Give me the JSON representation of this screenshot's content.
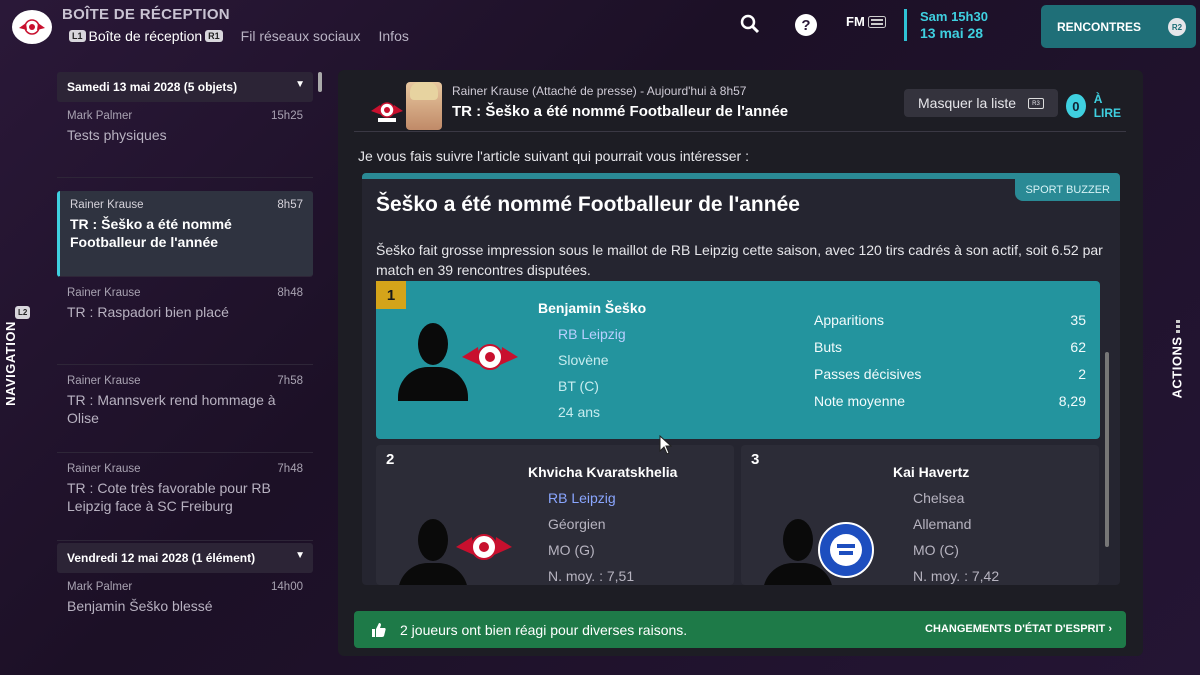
{
  "header": {
    "title": "BOÎTE DE RÉCEPTION",
    "hint_l1": "L1",
    "hint_r1": "R1",
    "tabs": [
      "Boîte de réception",
      "Fil réseaux sociaux",
      "Infos"
    ],
    "fm_label": "FM",
    "date_line1": "Sam 15h30",
    "date_line2": "13 mai 28",
    "matches_button": "RENCONTRES",
    "matches_hint": "R2",
    "icons": [
      "search-icon",
      "help-icon",
      "fm-keyboard-icon"
    ]
  },
  "side_nav": {
    "label": "NAVIGATION",
    "hint": "L2"
  },
  "side_actions": {
    "label": "ACTIONS"
  },
  "inbox": {
    "group1": "Samedi 13 mai 2028 (5 objets)",
    "group2": "Vendredi 12 mai 2028 (1 élément)",
    "messages": [
      {
        "sender": "Mark Palmer",
        "time": "15h25",
        "subject": "Tests physiques"
      },
      {
        "sender": "Rainer Krause",
        "time": "8h57",
        "subject": "TR : Šeško a été nommé Footballeur de l'année"
      },
      {
        "sender": "Rainer Krause",
        "time": "8h48",
        "subject": "TR : Raspadori bien placé"
      },
      {
        "sender": "Rainer Krause",
        "time": "7h58",
        "subject": "TR : Mannsverk rend hommage à Olise"
      },
      {
        "sender": "Rainer Krause",
        "time": "7h48",
        "subject": "TR : Cote très favorable pour RB Leipzig face à SC Freiburg"
      },
      {
        "sender": "Mark Palmer",
        "time": "14h00",
        "subject": "Benjamin Šeško blessé"
      }
    ]
  },
  "message": {
    "from": "Rainer Krause  (Attaché de presse)  -  Aujourd'hui à 8h57",
    "subject": "TR : Šeško a été nommé Footballeur de l'année",
    "hide_list": "Masquer la liste",
    "hide_hint": "R3",
    "unread_count": "0",
    "unread_label": "À LIRE",
    "intro": "Je vous fais suivre l'article suivant qui pourrait vous intéresser :"
  },
  "article": {
    "tag": "SPORT BUZZER",
    "title": "Šeško a été nommé Footballeur de l'année",
    "body": "Šeško fait grosse impression sous le maillot de RB Leipzig cette saison, avec 120 tirs cadrés à son actif, soit 6.52 par match en 39 rencontres disputées.",
    "first": {
      "rank": "1",
      "name": "Benjamin Šeško",
      "club": "RB Leipzig",
      "nationality": "Slovène",
      "position": "BT (C)",
      "age": "24 ans",
      "stats": [
        {
          "label": "Apparitions",
          "value": "35"
        },
        {
          "label": "Buts",
          "value": "62"
        },
        {
          "label": "Passes décisives",
          "value": "2"
        },
        {
          "label": "Note moyenne",
          "value": "8,29"
        }
      ]
    },
    "second": {
      "rank": "2",
      "name": "Khvicha Kvaratskhelia",
      "club": "RB Leipzig",
      "nationality": "Géorgien",
      "position": "MO (G)",
      "rating": "N. moy. : 7,51"
    },
    "third": {
      "rank": "3",
      "name": "Kai Havertz",
      "club": "Chelsea",
      "nationality": "Allemand",
      "position": "MO (C)",
      "rating": "N. moy. : 7,42"
    }
  },
  "footer": {
    "text": "2 joueurs ont bien réagi pour diverses raisons.",
    "cta": "CHANGEMENTS D'ÉTAT D'ESPRIT"
  },
  "colors": {
    "accent": "#3fd0e0",
    "highlight_card": "#23949e",
    "rank_gold": "#d4a41a",
    "footer_green": "#1e7a48"
  }
}
